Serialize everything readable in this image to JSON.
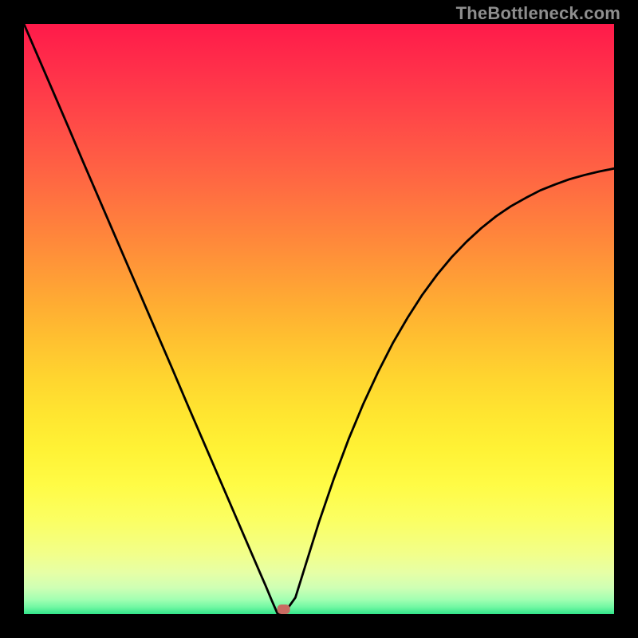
{
  "watermark": "TheBottleneck.com",
  "chart_data": {
    "type": "line",
    "title": "",
    "xlabel": "",
    "ylabel": "",
    "xlim": [
      0,
      1
    ],
    "ylim": [
      0,
      1
    ],
    "min_point_x": 0.43,
    "marker": {
      "x": 0.44,
      "y": 0.0,
      "color": "#c96b62"
    },
    "series": [
      {
        "name": "curve",
        "x": [
          0.0,
          0.025,
          0.05,
          0.075,
          0.1,
          0.125,
          0.15,
          0.175,
          0.2,
          0.225,
          0.25,
          0.275,
          0.3,
          0.325,
          0.35,
          0.375,
          0.4,
          0.41,
          0.42,
          0.43,
          0.44,
          0.45,
          0.46,
          0.475,
          0.5,
          0.525,
          0.55,
          0.575,
          0.6,
          0.625,
          0.65,
          0.675,
          0.7,
          0.725,
          0.75,
          0.775,
          0.8,
          0.825,
          0.85,
          0.875,
          0.9,
          0.925,
          0.95,
          0.975,
          1.0
        ],
        "y": [
          1.0,
          0.942,
          0.884,
          0.826,
          0.767,
          0.709,
          0.651,
          0.593,
          0.535,
          0.477,
          0.419,
          0.36,
          0.302,
          0.244,
          0.186,
          0.128,
          0.07,
          0.047,
          0.023,
          0.0,
          0.0,
          0.014,
          0.028,
          0.076,
          0.156,
          0.229,
          0.296,
          0.356,
          0.41,
          0.459,
          0.502,
          0.541,
          0.575,
          0.605,
          0.631,
          0.654,
          0.674,
          0.691,
          0.705,
          0.718,
          0.728,
          0.737,
          0.744,
          0.75,
          0.755
        ]
      }
    ],
    "gradient_stops": [
      {
        "offset": 0.0,
        "color": "#ff1a4a"
      },
      {
        "offset": 0.06,
        "color": "#ff2b4a"
      },
      {
        "offset": 0.12,
        "color": "#ff3c49"
      },
      {
        "offset": 0.18,
        "color": "#ff4e47"
      },
      {
        "offset": 0.24,
        "color": "#ff6044"
      },
      {
        "offset": 0.3,
        "color": "#ff7340"
      },
      {
        "offset": 0.36,
        "color": "#ff863b"
      },
      {
        "offset": 0.42,
        "color": "#ff9a37"
      },
      {
        "offset": 0.48,
        "color": "#ffae32"
      },
      {
        "offset": 0.54,
        "color": "#ffc230"
      },
      {
        "offset": 0.6,
        "color": "#ffd52f"
      },
      {
        "offset": 0.66,
        "color": "#ffe530"
      },
      {
        "offset": 0.72,
        "color": "#fff235"
      },
      {
        "offset": 0.78,
        "color": "#fffb45"
      },
      {
        "offset": 0.84,
        "color": "#fbff62"
      },
      {
        "offset": 0.898,
        "color": "#f2ff8a"
      },
      {
        "offset": 0.93,
        "color": "#e6ffa6"
      },
      {
        "offset": 0.955,
        "color": "#cfffb4"
      },
      {
        "offset": 0.975,
        "color": "#a3ffb2"
      },
      {
        "offset": 0.988,
        "color": "#72f8a3"
      },
      {
        "offset": 1.0,
        "color": "#31e58a"
      }
    ],
    "curve_style": {
      "stroke": "#000000",
      "stroke_width": 2.8
    }
  }
}
